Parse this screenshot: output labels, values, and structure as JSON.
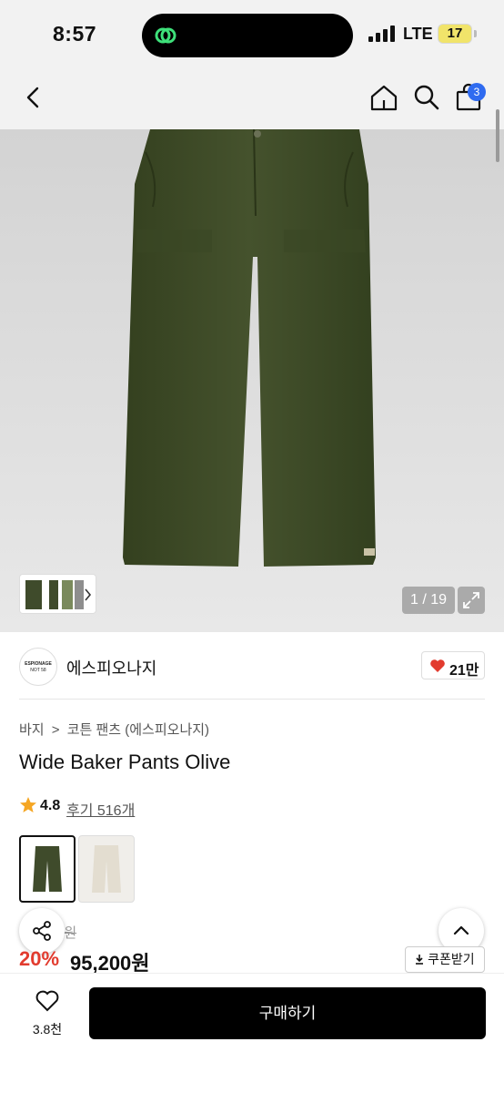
{
  "status_bar": {
    "time": "8:57",
    "network": "LTE",
    "battery": "17"
  },
  "header": {
    "cart_count": "3"
  },
  "gallery": {
    "counter": "1 / 19"
  },
  "brand": {
    "logo_text": "ESPIONAGE",
    "logo_subtext": "NOT 58",
    "name": "에스피오나지",
    "likes": "21만"
  },
  "breadcrumb": {
    "level1": "바지",
    "separator": ">",
    "level2": "코튼 팬츠 (에스피오나지)"
  },
  "product": {
    "title": "Wide Baker Pants Olive",
    "rating": "4.8",
    "reviews": "후기 516개",
    "original_price_visible": "9원",
    "discount": "20%",
    "price": "95,200원",
    "colors": [
      {
        "name": "olive",
        "hex": "#3d4a2a"
      },
      {
        "name": "ecru",
        "hex": "#e6e1d6"
      }
    ]
  },
  "actions": {
    "coupon_label": "쿠폰받기",
    "like_count": "3.8천",
    "buy_label": "구매하기"
  },
  "colors": {
    "accent_blue": "#2f6bf0",
    "sale_red": "#e23b2e",
    "olive": "#3f4b2b"
  },
  "icons": [
    "back-icon",
    "home-icon",
    "search-icon",
    "cart-icon",
    "expand-icon",
    "heart-icon",
    "star-icon",
    "share-icon",
    "chevron-up-icon",
    "download-icon"
  ]
}
